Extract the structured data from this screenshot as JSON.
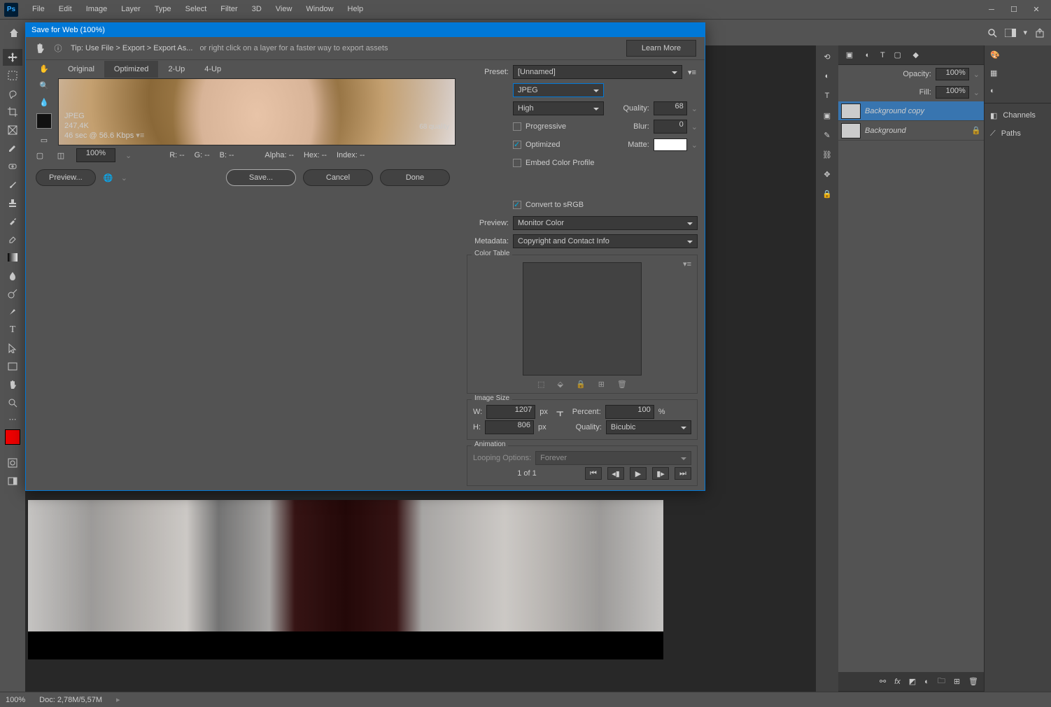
{
  "menu": {
    "items": [
      "File",
      "Edit",
      "Image",
      "Layer",
      "Type",
      "Select",
      "Filter",
      "3D",
      "View",
      "Window",
      "Help"
    ]
  },
  "topbar": {
    "search_icon": "search",
    "screen_icon": "screen",
    "share_icon": "share"
  },
  "dialog": {
    "title": "Save for Web (100%)",
    "tip_prefix": "Tip: Use File > Export > Export As...",
    "tip_suffix": "or right click on a layer for a faster way to export assets",
    "learn_more": "Learn More",
    "tabs": [
      "Original",
      "Optimized",
      "2-Up",
      "4-Up"
    ],
    "preview": {
      "format": "JPEG",
      "size": "247,4K",
      "time": "46 sec @ 56.6 Kbps",
      "quality": "68 quality"
    },
    "info_bar": {
      "zoom": "100%",
      "r": "R: --",
      "g": "G: --",
      "b": "B: --",
      "alpha": "Alpha: --",
      "hex": "Hex: --",
      "index": "Index: --"
    },
    "bottom": {
      "preview": "Preview...",
      "save": "Save...",
      "cancel": "Cancel",
      "done": "Done"
    },
    "preset": {
      "label": "Preset:",
      "value": "[Unnamed]"
    },
    "format": {
      "value": "JPEG"
    },
    "quality_mode": {
      "value": "High"
    },
    "quality": {
      "label": "Quality:",
      "value": "68"
    },
    "progressive": {
      "label": "Progressive"
    },
    "blur": {
      "label": "Blur:",
      "value": "0"
    },
    "optimized": {
      "label": "Optimized"
    },
    "matte": {
      "label": "Matte:"
    },
    "embed": {
      "label": "Embed Color Profile"
    },
    "convert": {
      "label": "Convert to sRGB"
    },
    "previewSel": {
      "label": "Preview:",
      "value": "Monitor Color"
    },
    "metadata": {
      "label": "Metadata:",
      "value": "Copyright and Contact Info"
    },
    "colorTable": {
      "label": "Color Table"
    },
    "imageSize": {
      "label": "Image Size",
      "w_label": "W:",
      "w": "1207",
      "h_label": "H:",
      "h": "806",
      "px": "px",
      "percent_label": "Percent:",
      "percent": "100",
      "percent_unit": "%",
      "quality_label": "Quality:",
      "quality": "Bicubic"
    },
    "animation": {
      "label": "Animation",
      "looping_label": "Looping Options:",
      "looping": "Forever",
      "frame": "1 of 1"
    }
  },
  "layers": {
    "opacity_label": "Opacity:",
    "opacity": "100%",
    "fill_label": "Fill:",
    "fill": "100%",
    "items": [
      {
        "name": "Background copy",
        "locked": false
      },
      {
        "name": "Background",
        "locked": true
      }
    ]
  },
  "rightPanels": {
    "channels": "Channels",
    "paths": "Paths"
  },
  "status": {
    "zoom": "100%",
    "doc": "Doc: 2,78M/5,57M"
  }
}
